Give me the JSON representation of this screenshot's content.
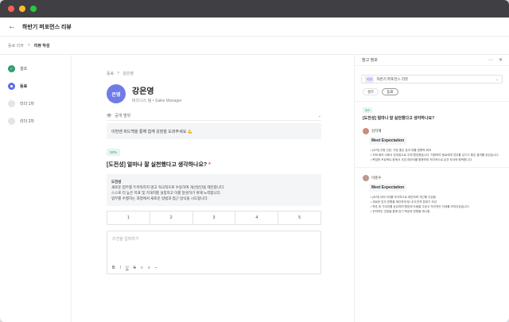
{
  "window": {
    "dots": [
      "#ff5f57",
      "#febc2e",
      "#28c840"
    ]
  },
  "header": {
    "title": "하반기 퍼포먼스 리뷰"
  },
  "breadcrumb": {
    "parent": "동료 리뷰",
    "separator": ">",
    "current": "리뷰 작성"
  },
  "steps": [
    {
      "label": "셀프",
      "state": "done"
    },
    {
      "label": "동료",
      "state": "active"
    },
    {
      "label": "리더 1차",
      "state": "todo"
    },
    {
      "label": "리더 2차",
      "state": "todo"
    }
  ],
  "main": {
    "crumb_parent": "동료",
    "crumb_sep": ">",
    "crumb_current": "강은영",
    "avatar_text": "은영",
    "name": "강은영",
    "role": "비즈니스 팀 • Sales Manager",
    "scope_label": "공개 범위",
    "notice": "이번엔 피드백을 통해 함께 성장을 도와주세요 💪",
    "progress_badge": "33%",
    "question": "[도전성] 얼마나 잘 실천했다고 생각하나요?",
    "required_mark": "*",
    "guide_title": "도전성",
    "guide_lines": [
      "새로운 업무를 두려워하지 않고 적극적으로 수용하여 개선방안을 제안합니다.",
      "스스로 더 높은 목표 및 기대치를 설정하고 이를 달성하기 위해 노력합니다.",
      "업무를 수행하는 과정에서 새로운 방법과 접근 방식을 시도합니다."
    ],
    "scale": [
      "1",
      "2",
      "3",
      "4",
      "5"
    ],
    "answer_placeholder": "의견을 입력하기",
    "toolbar": [
      "B",
      "I",
      "U",
      "S",
      "≡",
      "≡",
      "⌁"
    ]
  },
  "panel": {
    "title": "참고 정보",
    "more_icon": "⋯",
    "close_icon": "✕",
    "select_tag": "리뷰",
    "select_value": "하반기 퍼포먼스 리뷰",
    "pills": [
      {
        "label": "셀프",
        "on": false
      },
      {
        "label": "동료",
        "on": true
      }
    ],
    "badge": "3/5",
    "question": "[도전성] 얼마나 잘 실천했다고 생각하나요?",
    "reviews": [
      {
        "user": "김지혜",
        "label": "Meet Expectation",
        "lines": [
          "[요약] 주원 관련, 가장 좋은 효과 대를 경향력 회색",
          "저희 회의 이에서 업무팀으로 주에 협업했습니다. 지원하여 동료에게 업무를 넘기고 좋은 결과를 얻었습니다.",
          "복잡한 프로젝트 중에서 사업 데이터를 활용하여 적극적으로 유관 부서와 협력합니다."
        ]
      },
      {
        "user": "이준수",
        "label": "Meet Expectation",
        "lines": [
          "[요약] 아이디어를 적극적으로 제안하며 개선해 주었음",
          "새로운 업무 방향을 제안하여 팀 내 도전적 분위기 조성",
          "목표 및 기대치를 공유하며 협업에 도움을 주었고 적극적인 자세를 보여주었습니다.",
          "전략적인 관점을 통해 장기 목표와 방향을 제시함"
        ]
      }
    ]
  }
}
